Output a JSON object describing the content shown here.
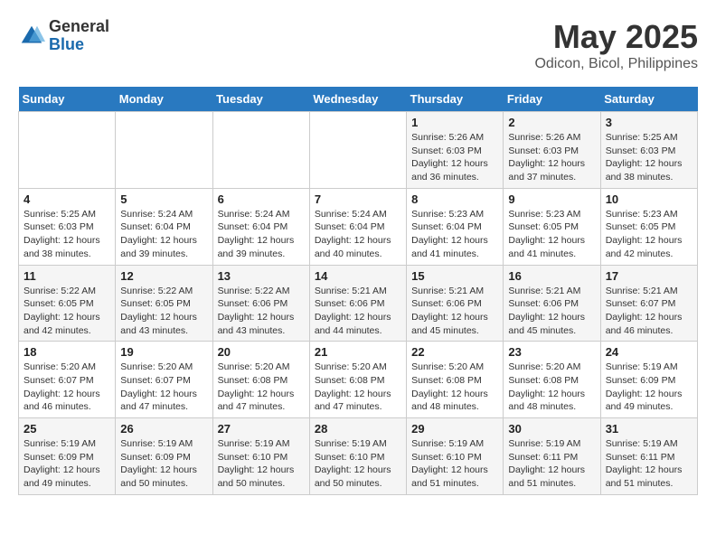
{
  "header": {
    "logo_general": "General",
    "logo_blue": "Blue",
    "title": "May 2025",
    "subtitle": "Odicon, Bicol, Philippines"
  },
  "days_of_week": [
    "Sunday",
    "Monday",
    "Tuesday",
    "Wednesday",
    "Thursday",
    "Friday",
    "Saturday"
  ],
  "weeks": [
    [
      {
        "day": "",
        "info": ""
      },
      {
        "day": "",
        "info": ""
      },
      {
        "day": "",
        "info": ""
      },
      {
        "day": "",
        "info": ""
      },
      {
        "day": "1",
        "info": "Sunrise: 5:26 AM\nSunset: 6:03 PM\nDaylight: 12 hours\nand 36 minutes."
      },
      {
        "day": "2",
        "info": "Sunrise: 5:26 AM\nSunset: 6:03 PM\nDaylight: 12 hours\nand 37 minutes."
      },
      {
        "day": "3",
        "info": "Sunrise: 5:25 AM\nSunset: 6:03 PM\nDaylight: 12 hours\nand 38 minutes."
      }
    ],
    [
      {
        "day": "4",
        "info": "Sunrise: 5:25 AM\nSunset: 6:03 PM\nDaylight: 12 hours\nand 38 minutes."
      },
      {
        "day": "5",
        "info": "Sunrise: 5:24 AM\nSunset: 6:04 PM\nDaylight: 12 hours\nand 39 minutes."
      },
      {
        "day": "6",
        "info": "Sunrise: 5:24 AM\nSunset: 6:04 PM\nDaylight: 12 hours\nand 39 minutes."
      },
      {
        "day": "7",
        "info": "Sunrise: 5:24 AM\nSunset: 6:04 PM\nDaylight: 12 hours\nand 40 minutes."
      },
      {
        "day": "8",
        "info": "Sunrise: 5:23 AM\nSunset: 6:04 PM\nDaylight: 12 hours\nand 41 minutes."
      },
      {
        "day": "9",
        "info": "Sunrise: 5:23 AM\nSunset: 6:05 PM\nDaylight: 12 hours\nand 41 minutes."
      },
      {
        "day": "10",
        "info": "Sunrise: 5:23 AM\nSunset: 6:05 PM\nDaylight: 12 hours\nand 42 minutes."
      }
    ],
    [
      {
        "day": "11",
        "info": "Sunrise: 5:22 AM\nSunset: 6:05 PM\nDaylight: 12 hours\nand 42 minutes."
      },
      {
        "day": "12",
        "info": "Sunrise: 5:22 AM\nSunset: 6:05 PM\nDaylight: 12 hours\nand 43 minutes."
      },
      {
        "day": "13",
        "info": "Sunrise: 5:22 AM\nSunset: 6:06 PM\nDaylight: 12 hours\nand 43 minutes."
      },
      {
        "day": "14",
        "info": "Sunrise: 5:21 AM\nSunset: 6:06 PM\nDaylight: 12 hours\nand 44 minutes."
      },
      {
        "day": "15",
        "info": "Sunrise: 5:21 AM\nSunset: 6:06 PM\nDaylight: 12 hours\nand 45 minutes."
      },
      {
        "day": "16",
        "info": "Sunrise: 5:21 AM\nSunset: 6:06 PM\nDaylight: 12 hours\nand 45 minutes."
      },
      {
        "day": "17",
        "info": "Sunrise: 5:21 AM\nSunset: 6:07 PM\nDaylight: 12 hours\nand 46 minutes."
      }
    ],
    [
      {
        "day": "18",
        "info": "Sunrise: 5:20 AM\nSunset: 6:07 PM\nDaylight: 12 hours\nand 46 minutes."
      },
      {
        "day": "19",
        "info": "Sunrise: 5:20 AM\nSunset: 6:07 PM\nDaylight: 12 hours\nand 47 minutes."
      },
      {
        "day": "20",
        "info": "Sunrise: 5:20 AM\nSunset: 6:08 PM\nDaylight: 12 hours\nand 47 minutes."
      },
      {
        "day": "21",
        "info": "Sunrise: 5:20 AM\nSunset: 6:08 PM\nDaylight: 12 hours\nand 47 minutes."
      },
      {
        "day": "22",
        "info": "Sunrise: 5:20 AM\nSunset: 6:08 PM\nDaylight: 12 hours\nand 48 minutes."
      },
      {
        "day": "23",
        "info": "Sunrise: 5:20 AM\nSunset: 6:08 PM\nDaylight: 12 hours\nand 48 minutes."
      },
      {
        "day": "24",
        "info": "Sunrise: 5:19 AM\nSunset: 6:09 PM\nDaylight: 12 hours\nand 49 minutes."
      }
    ],
    [
      {
        "day": "25",
        "info": "Sunrise: 5:19 AM\nSunset: 6:09 PM\nDaylight: 12 hours\nand 49 minutes."
      },
      {
        "day": "26",
        "info": "Sunrise: 5:19 AM\nSunset: 6:09 PM\nDaylight: 12 hours\nand 50 minutes."
      },
      {
        "day": "27",
        "info": "Sunrise: 5:19 AM\nSunset: 6:10 PM\nDaylight: 12 hours\nand 50 minutes."
      },
      {
        "day": "28",
        "info": "Sunrise: 5:19 AM\nSunset: 6:10 PM\nDaylight: 12 hours\nand 50 minutes."
      },
      {
        "day": "29",
        "info": "Sunrise: 5:19 AM\nSunset: 6:10 PM\nDaylight: 12 hours\nand 51 minutes."
      },
      {
        "day": "30",
        "info": "Sunrise: 5:19 AM\nSunset: 6:11 PM\nDaylight: 12 hours\nand 51 minutes."
      },
      {
        "day": "31",
        "info": "Sunrise: 5:19 AM\nSunset: 6:11 PM\nDaylight: 12 hours\nand 51 minutes."
      }
    ]
  ]
}
